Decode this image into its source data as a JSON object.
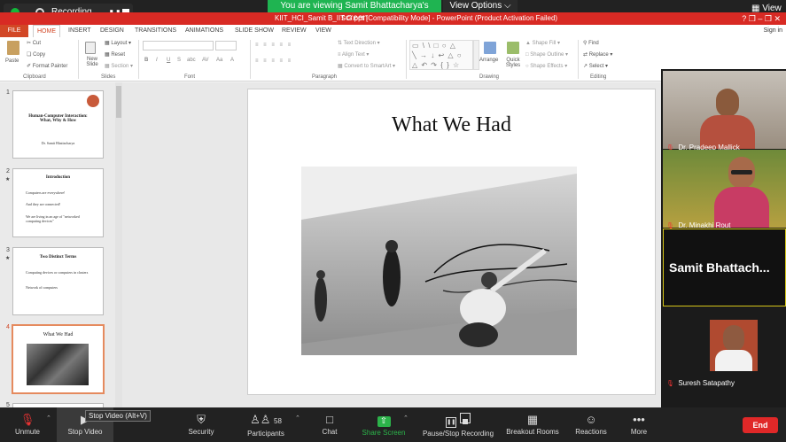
{
  "zoom_top": {
    "recording_label": "Recording...",
    "share_banner": "You are viewing Samit Bhattacharya's screen",
    "view_options": "View Options ⌵",
    "view_label": "View"
  },
  "ppt": {
    "title": "KIIT_HCI_Samit B_IIT G.ppt [Compatibility Mode] - PowerPoint (Product Activation Failed)",
    "window_controls": "?  ❐  –  ❐  ✕",
    "tabs": [
      "FILE",
      "HOME",
      "INSERT",
      "DESIGN",
      "TRANSITIONS",
      "ANIMATIONS",
      "SLIDE SHOW",
      "REVIEW",
      "VIEW"
    ],
    "sign_in": "Sign in",
    "ribbon": {
      "clipboard": {
        "paste": "Paste",
        "cut": "Cut",
        "copy": "Copy",
        "format_painter": "Format Painter",
        "group": "Clipboard"
      },
      "slides": {
        "new_slide": "New Slide",
        "layout": "Layout",
        "reset": "Reset",
        "section": "Section",
        "group": "Slides"
      },
      "font": {
        "group": "Font",
        "bold": "B",
        "italic": "I",
        "underline": "U",
        "strike": "S",
        "shadow": "abc",
        "spacing": "AV",
        "case": "Aa",
        "color": "A"
      },
      "paragraph": {
        "group": "Paragraph",
        "text_direction": "Text Direction",
        "align_text": "Align Text",
        "smartart": "Convert to SmartArt"
      },
      "drawing": {
        "group": "Drawing",
        "arrange": "Arrange",
        "quick_styles": "Quick Styles",
        "shape_fill": "Shape Fill",
        "shape_outline": "Shape Outline",
        "shape_effects": "Shape Effects"
      },
      "editing": {
        "group": "Editing",
        "find": "Find",
        "replace": "Replace",
        "select": "Select"
      }
    }
  },
  "slides_panel": {
    "thumbs": [
      {
        "num": "1",
        "title": "Human-Computer Interaction: What, Why & How",
        "body": "Dr. Samit Bhattacharya"
      },
      {
        "num": "2",
        "title": "Introduction",
        "b1": "Computers are everywhere!",
        "b2": "And they are connected!",
        "b3": "We are living in an age of \"networked computing devices\""
      },
      {
        "num": "3",
        "title": "Two Distinct Terms",
        "b1": "Computing devices or computers in clusters",
        "b2": "Network of computers"
      },
      {
        "num": "4",
        "title": "What We Had"
      },
      {
        "num": "5"
      }
    ]
  },
  "slide": {
    "title": "What We Had"
  },
  "participants": [
    {
      "name": "Dr. Pradeep Mallick"
    },
    {
      "name": "Dr. Minakhi Rout"
    },
    {
      "name": "Samit  Bhattach..."
    },
    {
      "name": "Suresh Satapathy"
    }
  ],
  "zoom_bottom": {
    "unmute": "Unmute",
    "stop_video": "Stop Video",
    "tooltip": "Stop Video (Alt+V)",
    "security": "Security",
    "participants": "Participants",
    "participants_count": "58",
    "chat": "Chat",
    "share_screen": "Share Screen",
    "pause_recording": "Pause/Stop Recording",
    "breakout": "Breakout Rooms",
    "reactions": "Reactions",
    "more": "More",
    "end": "End"
  }
}
